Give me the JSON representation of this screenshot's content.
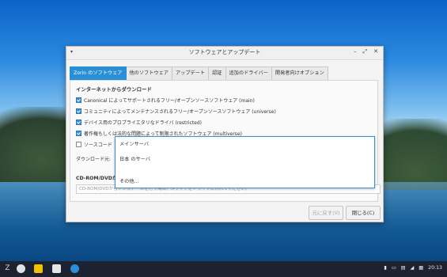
{
  "window": {
    "title": "ソフトウェアとアップデート",
    "menu_glyph": "▾",
    "controls": {
      "minimize": "–",
      "restore": "⤢",
      "close": "✕"
    }
  },
  "tabs": [
    {
      "label": "Zorin のソフトウェア",
      "active": true
    },
    {
      "label": "他のソフトウェア",
      "active": false
    },
    {
      "label": "アップデート",
      "active": false
    },
    {
      "label": "認証",
      "active": false
    },
    {
      "label": "追加のドライバー",
      "active": false
    },
    {
      "label": "開発者向けオプション",
      "active": false
    }
  ],
  "internet_section": {
    "title": "インターネットからダウンロード",
    "items": [
      {
        "label": "Canonical によってサポートされるフリー/オープンソースソフトウェア (main)",
        "checked": true
      },
      {
        "label": "コミュニティによってメンテナンスされるフリー/オープンソースソフトウェア (universe)",
        "checked": true
      },
      {
        "label": "デバイス用のプロプライエタリなドライバ (restricted)",
        "checked": true
      },
      {
        "label": "著作権もしくは法的な問題によって制限されたソフトウェア (multiverse)",
        "checked": true
      },
      {
        "label": "ソースコード",
        "checked": false
      }
    ],
    "download_from_label": "ダウンロード元:"
  },
  "dropdown": {
    "items": [
      "メインサーバ",
      "日本 のサーバ",
      "その他..."
    ]
  },
  "cdrom": {
    "title": "CD-ROM/DVDから",
    "placeholder": "CD-ROM/DVDからインストールを行う場合、メディアをドライブに入れてください。"
  },
  "buttons": {
    "revert": "元に戻す(V)",
    "close": "閉じる(C)"
  },
  "taskbar": {
    "clock": "20:13",
    "colors": {
      "files": "#f2c200",
      "active": "#2b8fd6"
    }
  }
}
